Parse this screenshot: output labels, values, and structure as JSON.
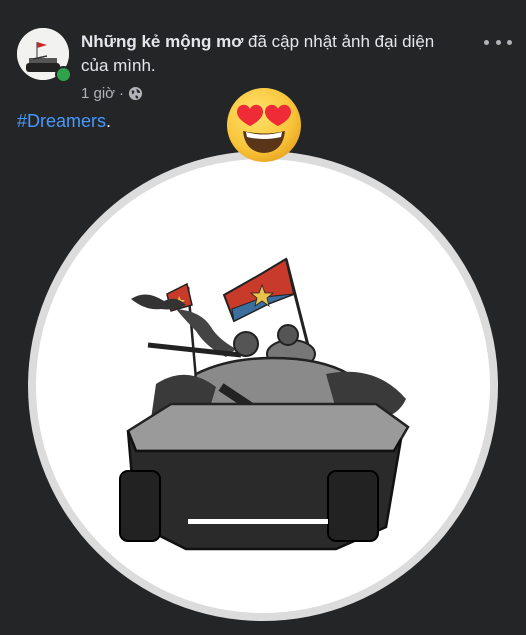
{
  "post": {
    "author": "Những kẻ mộng mơ",
    "action": " đã cập nhật ảnh đại diện của mình.",
    "time": "1 giờ",
    "separator": "·",
    "hashtag": "#Dreamers",
    "hashtag_suffix": "."
  },
  "icons": {
    "more": "more-options-icon",
    "privacy": "globe-icon",
    "reaction": "heart-eyes-emoji",
    "online": "online-status-dot"
  },
  "colors": {
    "background": "#242526",
    "text": "#e4e6eb",
    "secondary": "#b0b3b8",
    "hashtag": "#4599ff",
    "online": "#31a24c"
  }
}
